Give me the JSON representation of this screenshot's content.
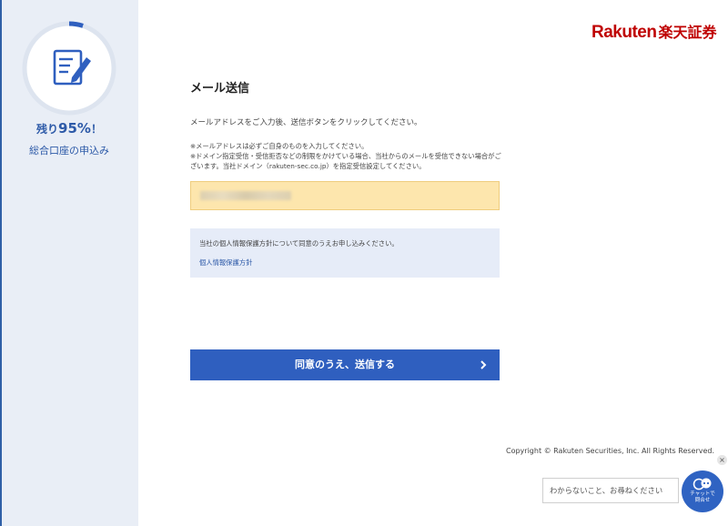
{
  "sidebar": {
    "progress_percent": 95,
    "remaining_prefix": "残り",
    "remaining_value": "95%",
    "remaining_suffix": "！",
    "app_name": "総合口座の申込み",
    "icon": "document-edit-icon"
  },
  "header": {
    "logo_en": "Rakuten",
    "logo_jp": "楽天証券",
    "brand_color": "#bf0000"
  },
  "main": {
    "title": "メール送信",
    "description": "メールアドレスをご入力後、送信ボタンをクリックしてください。",
    "notes": [
      "※メールアドレスは必ずご自身のものを入力してください。",
      "※ドメイン指定受信・受信拒否などの制限をかけている場合、当社からのメールを受信できない場合がございます。当社ドメイン（rakuten-sec.co.jp）を指定受信設定してください。"
    ],
    "privacy_text": "当社の個人情報保護方針について同意のうえお申し込みください。",
    "privacy_link": "個人情報保護方針",
    "submit_label": "同意のうえ、送信する"
  },
  "footer": {
    "copyright": "Copyright © Rakuten Securities, Inc. All Rights Reserved."
  },
  "chat": {
    "close_label": "×",
    "placeholder": "わからないこと、お尋ねください",
    "button_label_line1": "チャットで",
    "button_label_line2": "問合せ"
  },
  "colors": {
    "accent": "#2f5fbf",
    "sidebar_bg": "#e9eef6",
    "input_bg": "#fde6ad",
    "info_bg": "#e6ecf8"
  }
}
